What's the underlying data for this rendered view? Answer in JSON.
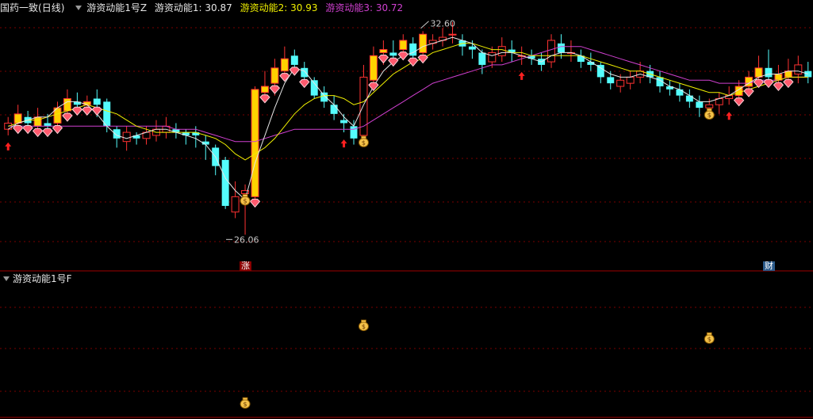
{
  "header": {
    "stock_name": "国药一致",
    "period": "(日线)",
    "indicator_name": "游资动能1号Z",
    "values": [
      {
        "label": "游资动能1:",
        "value": "30.87",
        "color": "#e6e6e6"
      },
      {
        "label": "游资动能2:",
        "value": "30.93",
        "color": "#f0f000"
      },
      {
        "label": "游资动能3:",
        "value": "30.72",
        "color": "#d040d0"
      }
    ]
  },
  "sub_panel": {
    "title": "游资动能1号F"
  },
  "markers": {
    "zhang": "涨",
    "cai": "财"
  },
  "colors": {
    "up": "#ff3232",
    "down": "#54fcfc",
    "gold": "#ffd200",
    "ma1": "#e6e6e6",
    "ma2": "#f0f000",
    "ma3": "#d040d0",
    "grid": "#7a0000",
    "border": "#a00000"
  },
  "chart_data": {
    "type": "candlestick",
    "ylim": [
      25.5,
      33.2
    ],
    "annotations": {
      "high_label": "32.60",
      "low_label": "26.06"
    },
    "candles": [
      [
        29.5,
        29.7,
        29.9,
        29.3
      ],
      [
        29.7,
        30.0,
        30.3,
        29.5
      ],
      [
        29.9,
        29.7,
        30.1,
        29.5
      ],
      [
        29.6,
        29.9,
        30.2,
        29.4
      ],
      [
        29.7,
        29.6,
        30.0,
        29.4
      ],
      [
        29.7,
        30.2,
        30.4,
        29.6
      ],
      [
        30.1,
        30.5,
        30.8,
        29.9
      ],
      [
        30.4,
        30.3,
        30.7,
        30.1
      ],
      [
        30.3,
        30.4,
        30.6,
        30.1
      ],
      [
        30.5,
        30.3,
        30.8,
        29.9
      ],
      [
        30.4,
        29.6,
        30.5,
        29.4
      ],
      [
        29.5,
        29.2,
        29.6,
        28.9
      ],
      [
        29.1,
        29.4,
        29.6,
        28.8
      ],
      [
        29.3,
        29.2,
        29.4,
        29.0
      ],
      [
        29.2,
        29.4,
        29.6,
        29.0
      ],
      [
        29.3,
        29.5,
        29.8,
        29.1
      ],
      [
        29.4,
        29.6,
        29.9,
        29.2
      ],
      [
        29.5,
        29.4,
        29.7,
        29.2
      ],
      [
        29.4,
        29.3,
        29.5,
        29.0
      ],
      [
        29.4,
        29.3,
        29.6,
        28.9
      ],
      [
        29.1,
        29.0,
        29.3,
        28.5
      ],
      [
        28.9,
        28.3,
        29.0,
        28.0
      ],
      [
        28.5,
        27.0,
        28.6,
        26.9
      ],
      [
        26.8,
        27.3,
        27.8,
        26.6
      ],
      [
        27.4,
        27.5,
        27.7,
        26.06
      ],
      [
        27.3,
        30.8,
        30.9,
        27.1
      ],
      [
        30.7,
        30.9,
        31.4,
        30.4
      ],
      [
        31.0,
        31.5,
        31.8,
        30.6
      ],
      [
        31.4,
        31.8,
        32.2,
        31.1
      ],
      [
        31.9,
        31.6,
        32.1,
        31.3
      ],
      [
        31.5,
        31.2,
        31.7,
        31.0
      ],
      [
        31.1,
        30.6,
        31.2,
        30.5
      ],
      [
        30.7,
        30.4,
        30.9,
        30.2
      ],
      [
        30.3,
        30.0,
        30.6,
        29.8
      ],
      [
        29.8,
        29.7,
        30.0,
        29.4
      ],
      [
        29.6,
        29.2,
        29.8,
        29.0
      ],
      [
        29.3,
        31.2,
        31.6,
        29.1
      ],
      [
        31.1,
        31.9,
        32.2,
        30.9
      ],
      [
        32.0,
        32.1,
        32.4,
        31.6
      ],
      [
        32.0,
        31.9,
        32.4,
        31.6
      ],
      [
        32.1,
        32.4,
        32.6,
        31.9
      ],
      [
        32.3,
        31.9,
        32.5,
        31.7
      ],
      [
        32.0,
        32.6,
        32.7,
        31.8
      ],
      [
        32.3,
        32.4,
        32.6,
        32.1
      ],
      [
        32.4,
        32.5,
        32.8,
        32.2
      ],
      [
        32.6,
        32.6,
        33.0,
        32.3
      ],
      [
        32.4,
        32.2,
        32.6,
        31.9
      ],
      [
        32.2,
        32.1,
        32.4,
        31.8
      ],
      [
        32.0,
        31.6,
        32.1,
        31.3
      ],
      [
        31.7,
        32.0,
        32.2,
        31.5
      ],
      [
        31.9,
        32.2,
        32.5,
        31.7
      ],
      [
        32.1,
        32.0,
        32.4,
        31.7
      ],
      [
        31.9,
        31.9,
        32.2,
        31.6
      ],
      [
        31.9,
        31.8,
        32.1,
        31.6
      ],
      [
        31.8,
        31.6,
        32.0,
        31.4
      ],
      [
        31.7,
        32.4,
        32.6,
        31.5
      ],
      [
        32.3,
        32.0,
        32.6,
        31.8
      ],
      [
        32.0,
        32.0,
        32.4,
        31.7
      ],
      [
        31.9,
        31.7,
        32.1,
        31.5
      ],
      [
        31.7,
        31.6,
        32.0,
        31.4
      ],
      [
        31.6,
        31.2,
        31.7,
        31.0
      ],
      [
        31.2,
        31.0,
        31.4,
        30.8
      ],
      [
        30.9,
        31.1,
        31.3,
        30.7
      ],
      [
        31.0,
        31.2,
        31.4,
        30.8
      ],
      [
        31.2,
        31.4,
        31.7,
        31.0
      ],
      [
        31.4,
        31.2,
        31.6,
        31.0
      ],
      [
        31.2,
        30.9,
        31.4,
        30.7
      ],
      [
        30.9,
        30.8,
        31.1,
        30.6
      ],
      [
        30.8,
        30.6,
        31.0,
        30.4
      ],
      [
        30.6,
        30.4,
        30.8,
        30.2
      ],
      [
        30.4,
        30.2,
        30.6,
        29.9
      ],
      [
        30.2,
        30.3,
        30.5,
        30.0
      ],
      [
        30.3,
        30.5,
        30.7,
        30.0
      ],
      [
        30.5,
        30.6,
        30.9,
        30.3
      ],
      [
        30.6,
        30.9,
        31.1,
        30.4
      ],
      [
        30.9,
        31.2,
        31.4,
        30.7
      ],
      [
        31.2,
        31.5,
        31.9,
        31.0
      ],
      [
        31.5,
        31.2,
        32.1,
        31.0
      ],
      [
        31.1,
        31.3,
        31.6,
        30.8
      ],
      [
        31.2,
        31.4,
        31.8,
        30.9
      ],
      [
        31.3,
        31.6,
        31.9,
        31.0
      ],
      [
        31.4,
        31.2,
        31.7,
        31.0
      ]
    ],
    "ma1": [
      29.5,
      29.7,
      29.8,
      29.9,
      29.9,
      30.2,
      30.4,
      30.4,
      30.3,
      30.0,
      29.6,
      29.3,
      29.2,
      29.3,
      29.4,
      29.5,
      29.5,
      29.4,
      29.3,
      29.2,
      29.0,
      28.6,
      27.9,
      27.5,
      27.2,
      28.4,
      29.3,
      30.2,
      31.0,
      31.5,
      31.4,
      31.0,
      30.6,
      30.3,
      29.9,
      29.6,
      30.3,
      30.9,
      31.4,
      31.7,
      31.9,
      32.0,
      32.2,
      32.3,
      32.4,
      32.5,
      32.4,
      32.3,
      32.0,
      31.9,
      32.0,
      32.0,
      31.9,
      31.8,
      31.7,
      31.9,
      32.0,
      32.0,
      31.9,
      31.7,
      31.5,
      31.3,
      31.2,
      31.2,
      31.3,
      31.2,
      31.1,
      30.9,
      30.8,
      30.6,
      30.4,
      30.4,
      30.5,
      30.6,
      30.8,
      31.0,
      31.2,
      31.3,
      31.3,
      31.4,
      31.4,
      31.3
    ],
    "ma2": [
      29.6,
      29.7,
      29.8,
      29.8,
      29.9,
      30.0,
      30.1,
      30.2,
      30.3,
      30.2,
      30.1,
      30.0,
      29.8,
      29.6,
      29.5,
      29.4,
      29.4,
      29.4,
      29.4,
      29.4,
      29.3,
      29.2,
      29.0,
      28.7,
      28.5,
      28.7,
      28.9,
      29.2,
      29.6,
      30.0,
      30.3,
      30.5,
      30.6,
      30.6,
      30.5,
      30.3,
      30.4,
      30.7,
      31.0,
      31.3,
      31.5,
      31.7,
      31.8,
      32.0,
      32.1,
      32.2,
      32.3,
      32.3,
      32.2,
      32.1,
      32.1,
      32.0,
      32.0,
      31.9,
      31.9,
      31.9,
      31.9,
      31.9,
      31.9,
      31.8,
      31.7,
      31.6,
      31.5,
      31.4,
      31.4,
      31.3,
      31.2,
      31.1,
      31.0,
      30.9,
      30.8,
      30.7,
      30.7,
      30.6,
      30.7,
      30.8,
      30.9,
      31.0,
      31.1,
      31.2,
      31.2,
      31.2
    ],
    "ma3": [
      29.6,
      29.6,
      29.6,
      29.6,
      29.6,
      29.6,
      29.6,
      29.6,
      29.6,
      29.6,
      29.6,
      29.6,
      29.6,
      29.6,
      29.6,
      29.6,
      29.6,
      29.5,
      29.5,
      29.5,
      29.4,
      29.3,
      29.2,
      29.1,
      29.1,
      29.1,
      29.2,
      29.3,
      29.4,
      29.5,
      29.5,
      29.5,
      29.5,
      29.5,
      29.5,
      29.5,
      29.6,
      29.8,
      30.0,
      30.2,
      30.4,
      30.6,
      30.8,
      31.0,
      31.1,
      31.2,
      31.3,
      31.4,
      31.5,
      31.6,
      31.6,
      31.7,
      31.8,
      31.9,
      32.0,
      32.1,
      32.2,
      32.2,
      32.2,
      32.1,
      32.0,
      31.9,
      31.8,
      31.7,
      31.6,
      31.5,
      31.4,
      31.3,
      31.2,
      31.1,
      31.1,
      31.1,
      31.0,
      31.0,
      31.0,
      31.0,
      31.1,
      31.1,
      31.1,
      31.2,
      31.2,
      31.2
    ],
    "diamond_bars": [
      1,
      2,
      3,
      4,
      5,
      6,
      7,
      8,
      9,
      25,
      26,
      27,
      28,
      29,
      30,
      37,
      38,
      39,
      40,
      41,
      42,
      74,
      75,
      76,
      77,
      78,
      79
    ],
    "up_arrow_bars": [
      0,
      34,
      52,
      73
    ],
    "money_bag_bars": [
      24,
      36,
      71
    ],
    "zhang_bar": 24,
    "cai_bar": 77
  }
}
